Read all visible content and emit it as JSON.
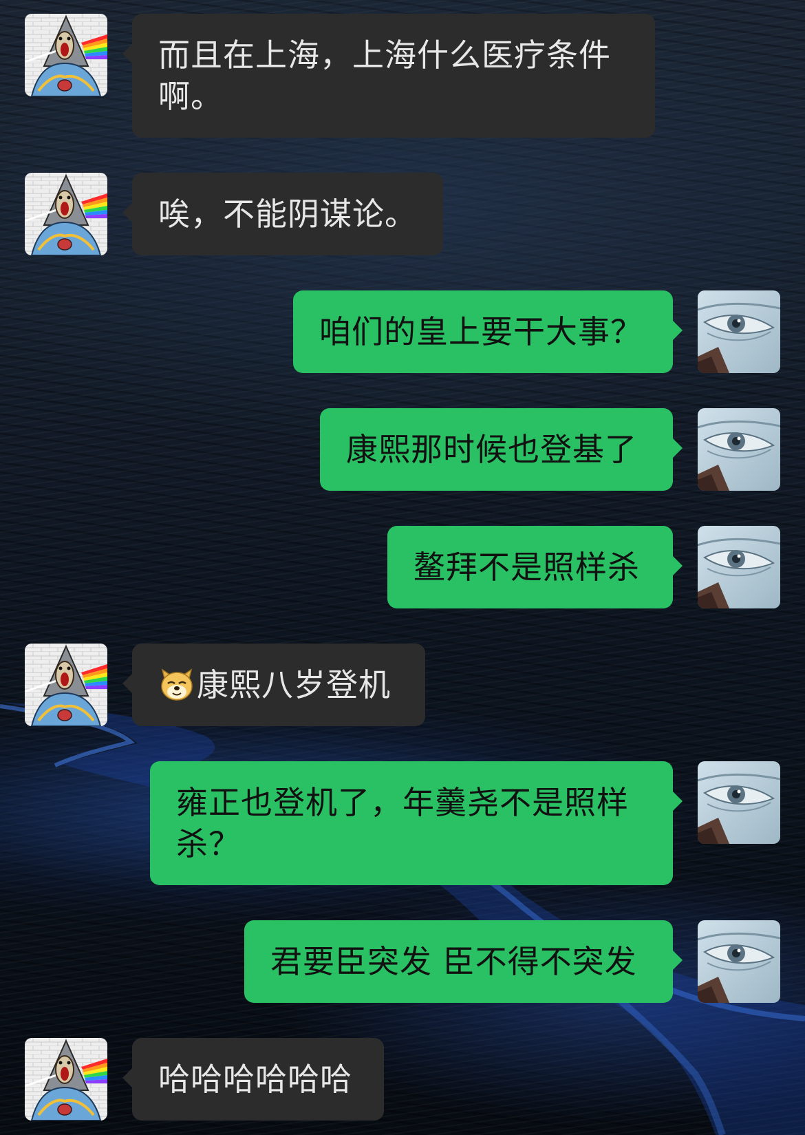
{
  "messages": [
    {
      "side": "in",
      "text": "而且在上海，上海什么医疗条件啊。"
    },
    {
      "side": "in",
      "text": "唉，不能阴谋论。"
    },
    {
      "side": "out",
      "text": "咱们的皇上要干大事？"
    },
    {
      "side": "out",
      "text": "康熙那时候也登基了"
    },
    {
      "side": "out",
      "text": "鳌拜不是照样杀"
    },
    {
      "side": "in",
      "emoji": "doge-emoji",
      "text": "康熙八岁登机"
    },
    {
      "side": "out",
      "text": "雍正也登机了，年羹尧不是照样杀？"
    },
    {
      "side": "out",
      "text": "君要臣突发 臣不得不突发"
    },
    {
      "side": "in",
      "text": "哈哈哈哈哈哈"
    }
  ],
  "colors": {
    "incoming_bubble": "#2c2c2c",
    "outgoing_bubble": "#29c163",
    "incoming_text": "#e7e7e7",
    "outgoing_text": "#111111"
  },
  "icons": {
    "incoming_avatar": "prism-scream-avatar-icon",
    "outgoing_avatar": "eye-closeup-avatar-icon"
  }
}
